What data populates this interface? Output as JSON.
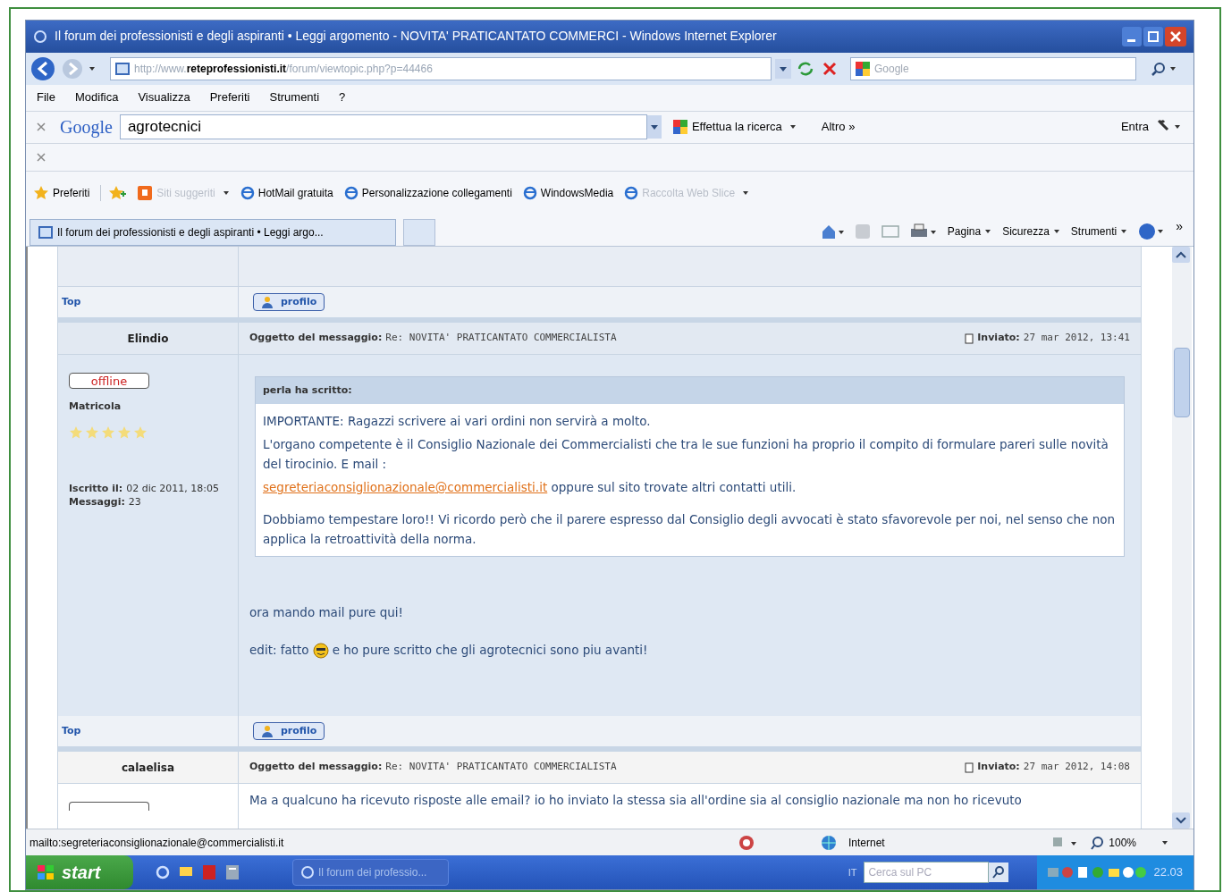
{
  "window": {
    "title": "Il forum dei professionisti e degli aspiranti • Leggi argomento - NOVITA' PRATICANTATO COMMERCI - Windows Internet Explorer"
  },
  "address_bar": {
    "prefix": "http://www.",
    "domain": "reteprofessionisti.it",
    "path": "/forum/viewtopic.php?p=44466"
  },
  "search_box": {
    "placeholder": "Google"
  },
  "menu": [
    "File",
    "Modifica",
    "Visualizza",
    "Preferiti",
    "Strumenti",
    "?"
  ],
  "google_toolbar": {
    "logo": "Google",
    "query": "agrotecnici",
    "search_button": "Effettua la ricerca",
    "more": "Altro »",
    "sign_in": "Entra"
  },
  "favorites_bar": {
    "label": "Preferiti",
    "items": [
      {
        "label": "Siti suggeriti",
        "kind": "suggested",
        "dimmed": true
      },
      {
        "label": "HotMail gratuita",
        "kind": "link",
        "dimmed": false
      },
      {
        "label": "Personalizzazione collegamenti",
        "kind": "link",
        "dimmed": false
      },
      {
        "label": "WindowsMedia",
        "kind": "link",
        "dimmed": false
      },
      {
        "label": "Raccolta Web Slice",
        "kind": "slice",
        "dimmed": true
      }
    ]
  },
  "tab": {
    "title": "Il forum dei professionisti e degli aspiranti • Leggi argo..."
  },
  "command_bar": {
    "items": [
      "Pagina",
      "Sicurezza",
      "Strumenti"
    ],
    "overflow": "»"
  },
  "forum": {
    "rows": [
      {
        "kind": "blank"
      },
      {
        "kind": "footer",
        "top": "Top",
        "profile": "profilo"
      },
      {
        "kind": "post",
        "author": "Elindio",
        "status": "offline",
        "rank": "Matricola",
        "stars": 5,
        "joined_label": "Iscritto il:",
        "joined": "02 dic 2011, 18:05",
        "posts_label": "Messaggi:",
        "posts": "23",
        "subject_label": "Oggetto del messaggio:",
        "subject": "Re: NOVITA' PRATICANTATO COMMERCIALISTA",
        "posted_label": "Inviato:",
        "posted": "27 mar 2012, 13:41",
        "quote": {
          "header": "perla ha scritto:",
          "blocks": [
            [
              {
                "text": "IMPORTANTE: Ragazzi scrivere ai vari ordini non servirà a molto."
              },
              {
                "text": "L'organo competente è il Consiglio Nazionale dei Commercialisti che tra le sue funzioni ha proprio il compito di formulare pareri sulle novità del tirocinio. E mail :"
              },
              {
                "link": "segreteriaconsiglionazionale@commercialisti.it",
                "text": " oppure sul sito trovate altri contatti utili."
              }
            ],
            [
              {
                "text": "Dobbiamo tempestare loro!! Vi ricordo però che il parere espresso dal Consiglio degli avvocati è stato sfavorevole per noi, nel senso che non applica la retroattività della norma."
              }
            ]
          ]
        },
        "body": [
          [
            {
              "kind": "text",
              "text": "ora mando mail pure qui!"
            }
          ],
          [
            {
              "kind": "text",
              "text": "edit: fatto"
            },
            {
              "kind": "smiley"
            },
            {
              "kind": "text",
              "text": "e ho pure scritto che gli agrotecnici sono piu avanti!"
            }
          ]
        ]
      },
      {
        "kind": "footer",
        "top": "Top",
        "profile": "profilo"
      },
      {
        "kind": "post",
        "author": "calaelisa",
        "subject_label": "Oggetto del messaggio:",
        "subject": "Re: NOVITA' PRATICANTATO COMMERCIALISTA",
        "posted_label": "Inviato:",
        "posted": "27 mar 2012, 14:08",
        "body": [
          [
            {
              "kind": "text",
              "text": "Ma a qualcuno ha ricevuto risposte alle email? io ho inviato la stessa sia all'ordine sia al consiglio nazionale ma non ho ricevuto"
            }
          ]
        ]
      }
    ]
  },
  "status_bar": {
    "text": "mailto:segreteriaconsiglionazionale@commercialisti.it",
    "zone": "Internet",
    "zoom": "100%"
  },
  "taskbar": {
    "start": "start",
    "task": "Il forum dei professio...",
    "language": "IT",
    "search_placeholder": "Cerca sul PC",
    "clock": "22.03"
  }
}
